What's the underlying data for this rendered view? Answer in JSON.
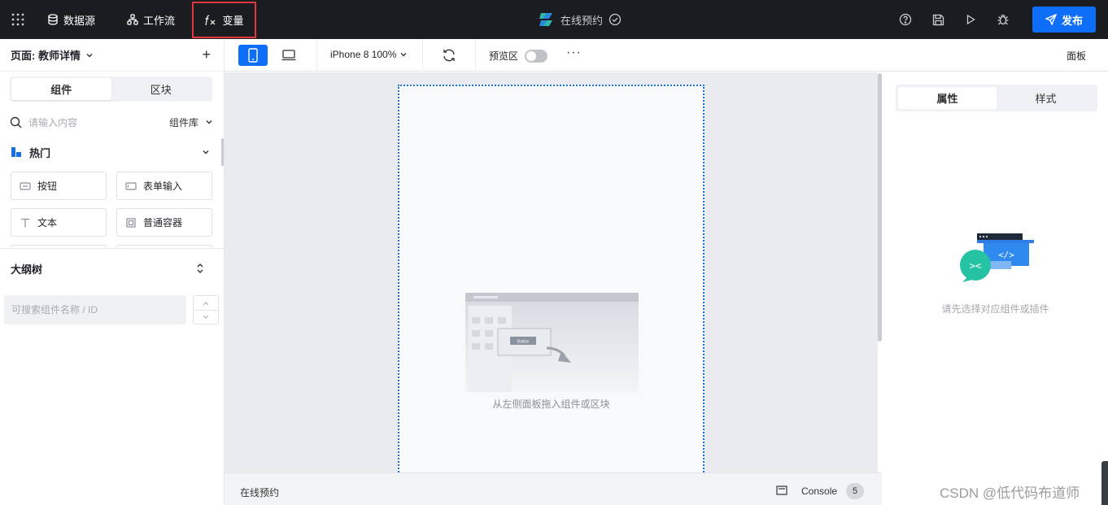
{
  "topbar": {
    "datasource": "数据源",
    "workflow": "工作流",
    "variable": "变量",
    "app_title": "在线预约",
    "publish": "发布"
  },
  "left": {
    "page_label": "页面: 教师详情",
    "tabs": [
      "组件",
      "区块"
    ],
    "search_placeholder": "请输入内容",
    "library": "组件库",
    "category": "热门",
    "components": [
      "按钮",
      "表单输入",
      "文本",
      "普通容器"
    ],
    "outline_title": "大纲树",
    "outline_search_placeholder": "可搜索组件名称 / ID"
  },
  "toolbar": {
    "device": "iPhone 8 100%",
    "preview": "预览区",
    "more": "···",
    "panel": "面板"
  },
  "canvas": {
    "drop_hint": "从左侧面板拖入组件或区块",
    "illus_button": "Button"
  },
  "status": {
    "app_name": "在线预约",
    "console": "Console",
    "console_count": "5"
  },
  "right": {
    "tabs": [
      "属性",
      "样式"
    ],
    "empty_text": "请先选择对应组件或插件"
  },
  "watermark": "CSDN @低代码布道师",
  "colors": {
    "topbar_bg": "#1b1c1f",
    "accent": "#0f6ef7",
    "highlight": "#e0383e"
  }
}
